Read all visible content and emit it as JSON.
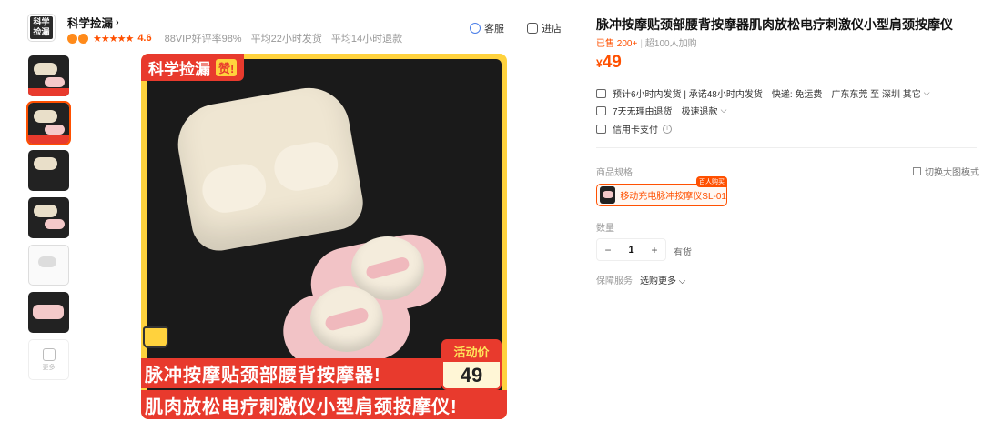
{
  "store": {
    "logo_text": "科学捡漏",
    "name": "科学捡漏",
    "rating": "4.6",
    "stars": "★★★★★",
    "meta": [
      "88VIP好评率98%",
      "平均22小时发货",
      "平均14小时退款"
    ]
  },
  "header": {
    "service_label": "客服",
    "shop_label": "进店"
  },
  "thumbs": {
    "more_label": "更多"
  },
  "image": {
    "tag": "科学捡漏",
    "tag_badge": "赞!",
    "banner_line1": "脉冲按摩贴颈部腰背按摩器!",
    "banner_line2": "肌肉放松电疗刺激仪小型肩颈按摩仪!",
    "promo_label": "活动价",
    "promo_price": "49"
  },
  "product": {
    "title": "脉冲按摩贴颈部腰背按摩器肌肉放松电疗刺激仪小型肩颈按摩仪",
    "sold": "已售 200+",
    "cart": "超100人加购",
    "currency": "¥",
    "price": "49"
  },
  "shipping": {
    "promise": "预计6小时内发货 | 承诺48小时内发货",
    "express": "快递: 免运费",
    "route": "广东东莞 至 深圳 其它"
  },
  "returns": {
    "policy": "7天无理由退货",
    "fast": "极速退款"
  },
  "payment": {
    "label": "信用卡支付",
    "info": "i"
  },
  "spec": {
    "label": "商品规格",
    "switch_view": "切换大图模式",
    "option": "移动充电脉冲按摩仪SL-01",
    "hot_badge": "百人购买"
  },
  "quantity": {
    "label": "数量",
    "minus": "−",
    "value": "1",
    "plus": "+",
    "stock": "有货"
  },
  "guarantee": {
    "label": "保障服务",
    "value": "选购更多"
  },
  "colors": {
    "accent": "#ff5000",
    "banner_red": "#e83a2d",
    "banner_yellow": "#ffd23d"
  }
}
